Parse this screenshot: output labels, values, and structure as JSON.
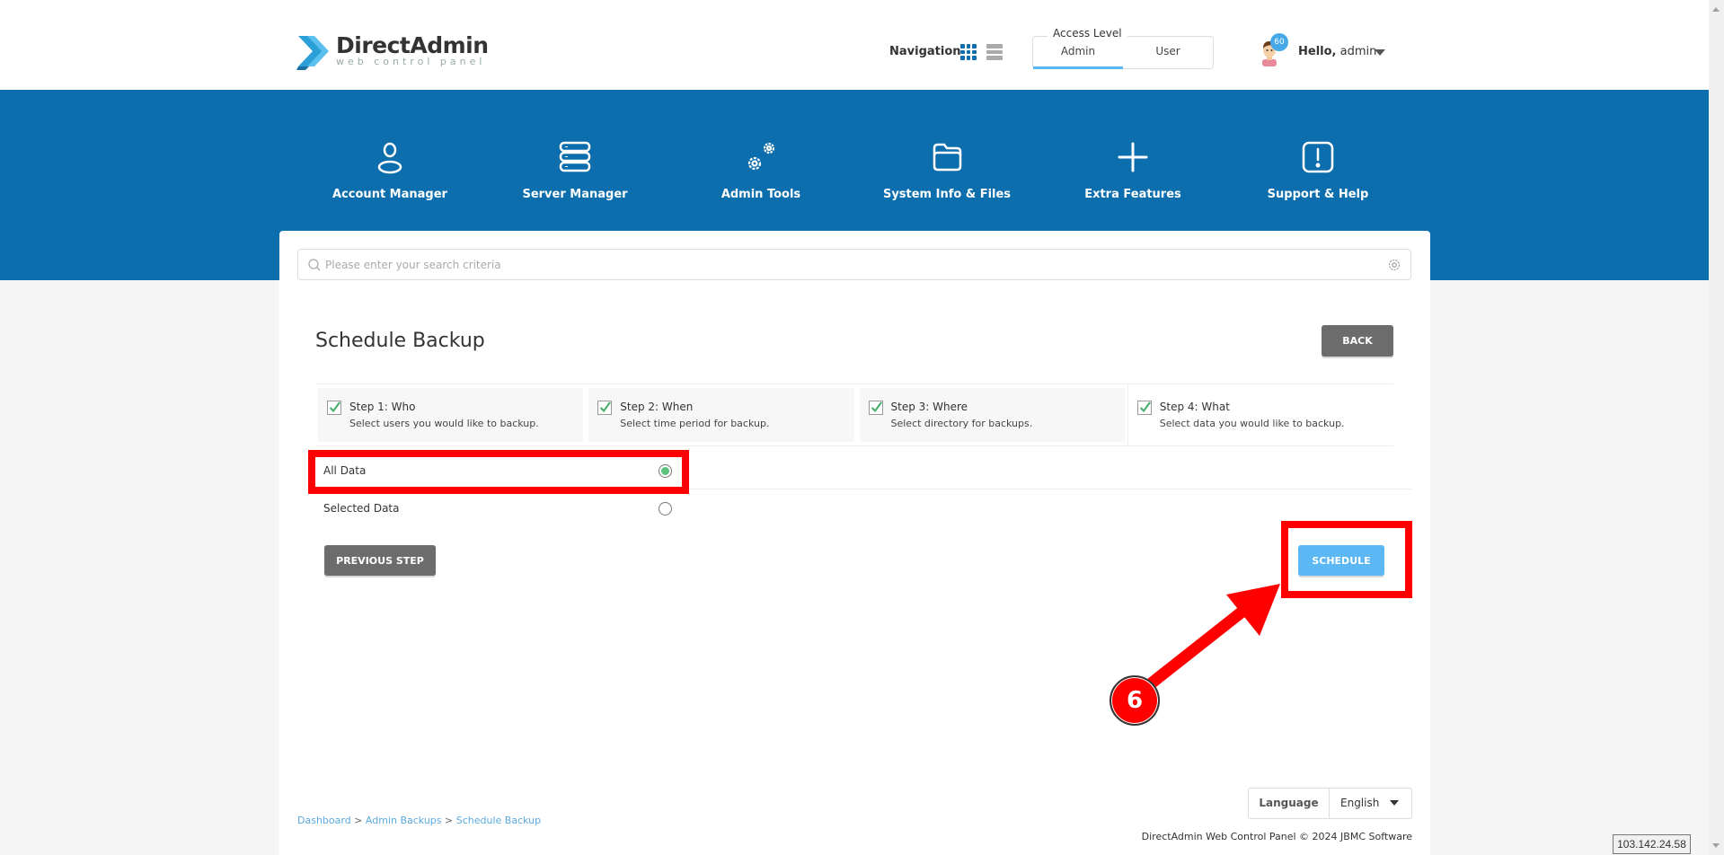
{
  "app": {
    "logo_title": "DirectAdmin",
    "logo_subtitle": "web control panel"
  },
  "header": {
    "navigation_label": "Navigation",
    "access_level": {
      "legend": "Access Level",
      "options": [
        "Admin",
        "User"
      ],
      "selected": "Admin"
    },
    "notification_count": "60",
    "greeting_prefix": "Hello,",
    "username": "admin"
  },
  "menu": {
    "items": [
      {
        "label": "Account Manager",
        "icon": "user-icon"
      },
      {
        "label": "Server Manager",
        "icon": "server-icon"
      },
      {
        "label": "Admin Tools",
        "icon": "gears-icon"
      },
      {
        "label": "System Info & Files",
        "icon": "folder-icon"
      },
      {
        "label": "Extra Features",
        "icon": "plus-icon"
      },
      {
        "label": "Support & Help",
        "icon": "alert-icon"
      }
    ]
  },
  "search": {
    "placeholder": "Please enter your search criteria",
    "value": ""
  },
  "page": {
    "title": "Schedule Backup",
    "back_label": "BACK"
  },
  "steps": [
    {
      "title": "Step 1: Who",
      "desc": "Select users you would like to backup.",
      "checked": true
    },
    {
      "title": "Step 2: When",
      "desc": "Select time period for backup.",
      "checked": true
    },
    {
      "title": "Step 3: Where",
      "desc": "Select directory for backups.",
      "checked": true
    },
    {
      "title": "Step 4: What",
      "desc": "Select data you would like to backup.",
      "checked": true
    }
  ],
  "options": [
    {
      "label": "All Data",
      "selected": true
    },
    {
      "label": "Selected Data",
      "selected": false
    }
  ],
  "actions": {
    "previous_label": "PREVIOUS STEP",
    "schedule_label": "SCHEDULE"
  },
  "footer": {
    "language_label": "Language",
    "language_value": "English",
    "breadcrumb": [
      "Dashboard",
      "Admin Backups",
      "Schedule Backup"
    ],
    "breadcrumb_sep": ">",
    "copyright": "DirectAdmin Web Control Panel © 2024 JBMC Software"
  },
  "tooltip": {
    "ip": "103.142.24.58"
  },
  "annotation": {
    "step_number": "6"
  },
  "colors": {
    "brand_blue": "#0d6ead",
    "accent_light_blue": "#5bb8f5",
    "highlight_red": "#ff0000",
    "radio_green": "#5ac27b",
    "button_gray": "#6b6c6b"
  }
}
